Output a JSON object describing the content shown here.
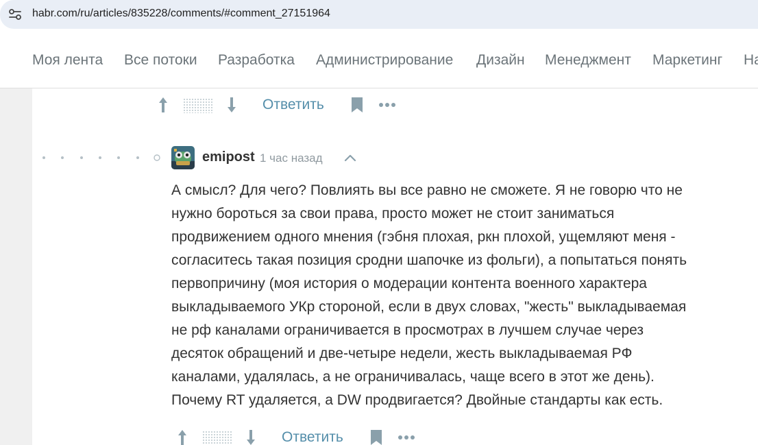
{
  "browser": {
    "url": "habr.com/ru/articles/835228/comments/#comment_27151964",
    "site_info_icon": "tune-icon"
  },
  "nav": {
    "items": [
      "Моя лента",
      "Все потоки",
      "Разработка",
      "Администрирование",
      "Дизайн",
      "Менеджмент",
      "Маркетинг",
      "На"
    ]
  },
  "previous_comment_actions": {
    "reply_label": "Ответить",
    "upvote_icon": "arrow-up-icon",
    "downvote_icon": "arrow-down-icon",
    "bookmark_icon": "bookmark-icon",
    "more_icon": "more-dots-icon"
  },
  "comment": {
    "author": "emipost",
    "time": "1 час назад",
    "collapse_icon": "chevron-up-icon",
    "lines": [
      "А смысл? Для чего? Повлиять вы все равно не сможете. Я не говорю что не",
      "нужно бороться за свои права, просто может не стоит заниматься",
      "продвижением одного мнения (гэбня плохая, ркн плохой, ущемляют меня -",
      "согласитесь такая позиция сродни шапочке из фольги), а попытаться понять",
      "первопричину (моя история о модерации контента военного характера",
      "выкладываемого УКр стороной, если в двух словах, \"жесть\" выкладываемая",
      "не рф каналами ограничивается в просмотрах в лучшем случае через",
      "десяток обращений и две-четыре недели, жесть выкладываемая РФ",
      "каналами, удалялась, а не ограничивалась, чаще всего в этот же день).",
      "Почему RT удаляется, а DW продвигается? Двойные стандарты как есть."
    ],
    "actions": {
      "reply_label": "Ответить"
    }
  },
  "colors": {
    "nav_text": "#6b7479",
    "link": "#548eaa",
    "body_text": "#333333",
    "muted": "#909aa0",
    "icon": "#8aa0ab"
  }
}
